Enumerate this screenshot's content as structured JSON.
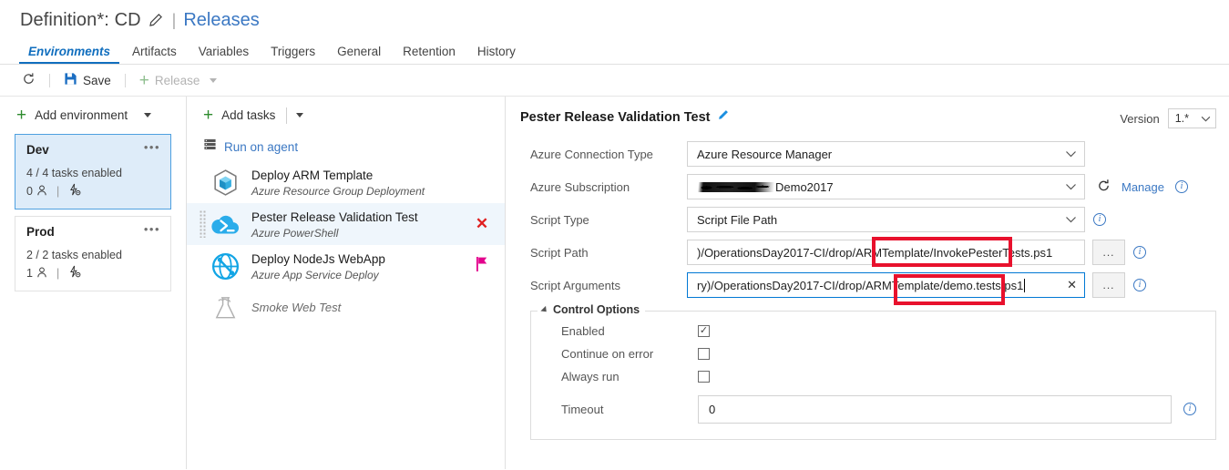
{
  "header": {
    "definition_label": "Definition*: CD",
    "edit_icon": "pencil-icon",
    "separator": "|",
    "releases_link": "Releases"
  },
  "tabs": [
    {
      "label": "Environments",
      "active": true
    },
    {
      "label": "Artifacts",
      "active": false
    },
    {
      "label": "Variables",
      "active": false
    },
    {
      "label": "Triggers",
      "active": false
    },
    {
      "label": "General",
      "active": false
    },
    {
      "label": "Retention",
      "active": false
    },
    {
      "label": "History",
      "active": false
    }
  ],
  "toolbar": {
    "refresh_icon": "refresh-icon",
    "save_label": "Save",
    "save_icon": "save-disk-icon",
    "release_label": "Release",
    "release_disabled": true
  },
  "environments_panel": {
    "add_label": "Add environment",
    "cards": [
      {
        "name": "Dev",
        "tasks_text": "4 / 4 tasks enabled",
        "approvers_count": "0",
        "selected": true
      },
      {
        "name": "Prod",
        "tasks_text": "2 / 2 tasks enabled",
        "approvers_count": "1",
        "selected": false
      }
    ]
  },
  "tasks_panel": {
    "add_label": "Add tasks",
    "phase_label": "Run on agent",
    "phase_icon": "agent-server-icon",
    "tasks": [
      {
        "name": "Deploy ARM Template",
        "subtitle": "Azure Resource Group Deployment",
        "icon": "arm-cube-icon",
        "selected": false,
        "status": "",
        "disabled": false
      },
      {
        "name": "Pester Release Validation Test",
        "subtitle": "Azure PowerShell",
        "icon": "azure-powershell-cloud-icon",
        "selected": true,
        "status": "error-x",
        "disabled": false
      },
      {
        "name": "Deploy NodeJs WebApp",
        "subtitle": "Azure App Service Deploy",
        "icon": "web-globe-icon",
        "selected": false,
        "status": "flag",
        "disabled": false
      },
      {
        "name": "Smoke Web Test",
        "subtitle": "",
        "icon": "flask-beaker-icon",
        "selected": false,
        "status": "",
        "disabled": true
      }
    ]
  },
  "detail": {
    "title": "Pester Release Validation Test",
    "edit_icon": "pencil-icon",
    "version_label": "Version",
    "version_value": "1.*",
    "fields": {
      "connection_type": {
        "label": "Azure Connection Type",
        "value": "Azure Resource Manager"
      },
      "subscription": {
        "label": "Azure Subscription",
        "value": "Demo2017",
        "redacted": true,
        "manage_label": "Manage",
        "refresh_icon": "refresh-icon"
      },
      "script_type": {
        "label": "Script Type",
        "value": "Script File Path"
      },
      "script_path": {
        "label": "Script Path",
        "value_prefix": ")/OperationsDay2017-CI/drop/ARMTemplate",
        "value_highlight": "/InvokePesterTests.ps1",
        "browse_label": "...",
        "annotated": true
      },
      "script_arguments": {
        "label": "Script Arguments",
        "value_prefix": "ry)/OperationsDay2017-CI/drop/ARMTemplate",
        "value_highlight": "/demo.tests.ps1",
        "browse_label": "...",
        "clear_icon": "clear-x-icon",
        "focused": true,
        "annotated": true
      }
    },
    "control_options": {
      "legend": "Control Options",
      "rows": [
        {
          "label": "Enabled",
          "checked": true
        },
        {
          "label": "Continue on error",
          "checked": false
        },
        {
          "label": "Always run",
          "checked": false
        }
      ],
      "timeout_label": "Timeout",
      "timeout_value": "0"
    }
  },
  "colors": {
    "accent_blue": "#3b78c3",
    "tab_active": "#106ebe",
    "selected_bg": "#deecf9",
    "task_selected_bg": "#eff6fc",
    "green_plus": "#2e8b2e",
    "error_red": "#e02020",
    "flag_magenta": "#e3008c",
    "annotation_red": "#e8112d"
  }
}
